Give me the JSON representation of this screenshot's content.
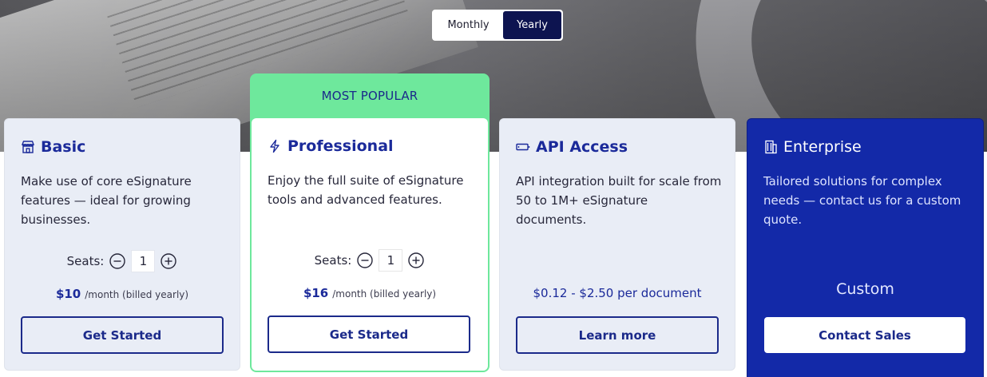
{
  "billing_toggle": {
    "monthly_label": "Monthly",
    "yearly_label": "Yearly",
    "selected": "Yearly"
  },
  "popular_label": "MOST POPULAR",
  "colors": {
    "accent": "#1b2a9a",
    "popular_green": "#6ee89c",
    "enterprise_bg": "#1329a8",
    "toggle_active": "#0d1450"
  },
  "plans": [
    {
      "title": "Basic",
      "icon": "storefront-icon",
      "description": "Make use of core eSignature features — ideal for growing businesses.",
      "seats_label": "Seats:",
      "seats_value": "1",
      "price_amount": "$10",
      "price_note": "/month (billed yearly)",
      "cta_label": "Get Started"
    },
    {
      "title": "Professional",
      "icon": "lightning-icon",
      "description": "Enjoy the full suite of eSignature tools and advanced features.",
      "seats_label": "Seats:",
      "seats_value": "1",
      "price_amount": "$16",
      "price_note": "/month (billed yearly)",
      "cta_label": "Get Started"
    },
    {
      "title": "API Access",
      "icon": "battery-icon",
      "description": "API integration built for scale from 50 to 1M+ eSignature documents.",
      "price_range": "$0.12 - $2.50 per document",
      "cta_label": "Learn more"
    },
    {
      "title": "Enterprise",
      "icon": "building-icon",
      "description": "Tailored solutions for complex needs — contact us for a custom quote.",
      "price_label": "Custom",
      "cta_label": "Contact Sales"
    }
  ]
}
